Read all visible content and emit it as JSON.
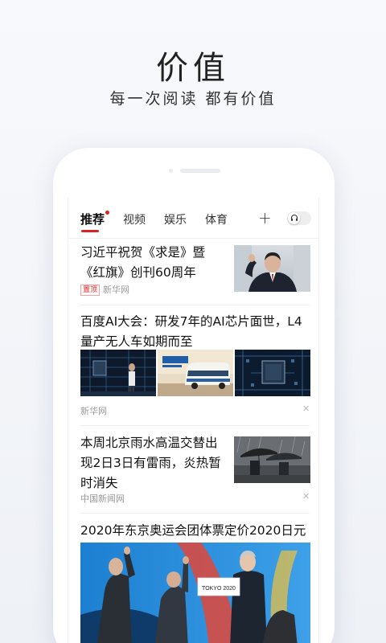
{
  "promo": {
    "title": "价值",
    "subtitle": "每一次阅读 都有价值"
  },
  "tabs": [
    {
      "label": "推荐",
      "active": true
    },
    {
      "label": "视频",
      "active": false
    },
    {
      "label": "娱乐",
      "active": false
    },
    {
      "label": "体育",
      "active": false
    }
  ],
  "toolbar": {
    "plus_icon": "plus-icon",
    "audio_toggle_icon": "headphone-icon",
    "audio_toggle_on": false
  },
  "feed": [
    {
      "title": "习近平祝贺《求是》暨《红旗》创刊60周年",
      "badge": "置顶",
      "source": "新华网",
      "images": 1
    },
    {
      "title": "百度AI大会：研发7年的AI芯片面世，L4量产无人车如期而至",
      "source": "新华网",
      "images": 3
    },
    {
      "title": "本周北京雨水高温交替出现2日3日有雷雨，炎热暂时消失",
      "source": "中国新闻网",
      "images": 1
    },
    {
      "title": "2020年东京奥运会团体票定价2020日元",
      "images": 1,
      "sign_text": "TOKYO 2020"
    }
  ],
  "colors": {
    "accent": "#e02020",
    "background": "#f3f5f9",
    "text": "#111111",
    "meta": "#999999"
  }
}
